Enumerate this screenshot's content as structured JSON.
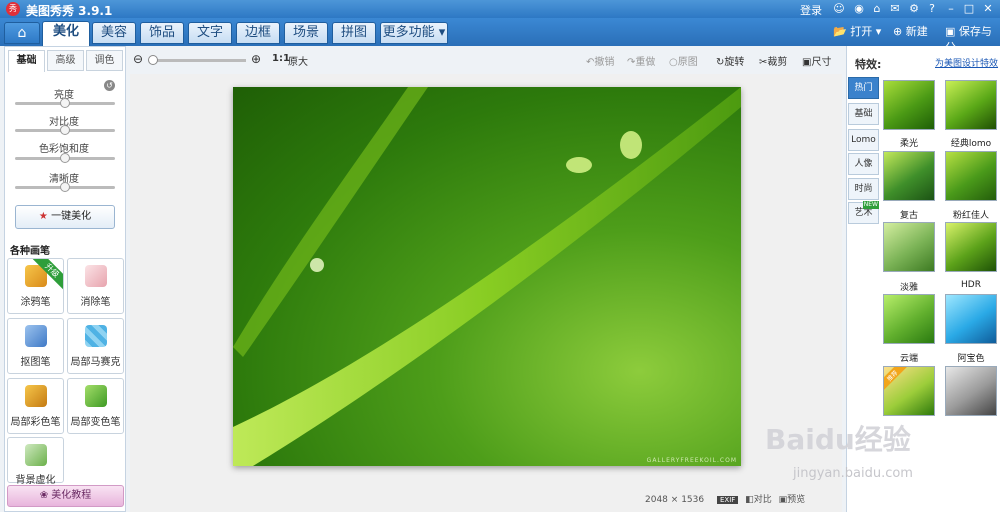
{
  "titlebar": {
    "logo": "秀",
    "title": "美图秀秀 3.9.1",
    "login": "登录"
  },
  "tabs": {
    "home_icon": "home-icon",
    "items": [
      "美化",
      "美容",
      "饰品",
      "文字",
      "边框",
      "场景",
      "拼图",
      "更多功能"
    ]
  },
  "actions": {
    "open": "打开",
    "new": "新建",
    "save": "保存与分"
  },
  "zoom": {
    "ratio": "1:1",
    "fit_label": "原大"
  },
  "toolbar": {
    "undo": "撤销",
    "redo": "重做",
    "original": "原图",
    "rotate": "旋转",
    "crop": "裁剪",
    "size": "尺寸"
  },
  "left": {
    "subtabs": [
      "基础",
      "高级",
      "调色"
    ],
    "sliders": [
      {
        "label": "亮度",
        "value": 0.5
      },
      {
        "label": "对比度",
        "value": 0.5
      },
      {
        "label": "色彩饱和度",
        "value": 0.5
      },
      {
        "label": "清晰度",
        "value": 0.5
      }
    ],
    "one_click": "一键美化",
    "brushes_title": "各种画笔",
    "brushes": [
      {
        "label": "涂鸦笔",
        "badge": "升级"
      },
      {
        "label": "消除笔"
      },
      {
        "label": "抠图笔"
      },
      {
        "label": "局部马赛克"
      },
      {
        "label": "局部彩色笔"
      },
      {
        "label": "局部变色笔"
      },
      {
        "label": "背景虚化"
      }
    ],
    "tutorial": "美化教程"
  },
  "photo": {
    "watermark": "GALLERYFREEKOIL.COM"
  },
  "status": {
    "width": "2048",
    "times": "×",
    "height": "1536",
    "exif": "EXIF",
    "compare": "对比",
    "preview": "预览"
  },
  "right": {
    "title": "特效:",
    "design_link": "为美图设计特效",
    "cats": [
      "热门",
      "基础",
      "Lomo",
      "人像",
      "时尚",
      "艺术"
    ],
    "new_badge": "NEW",
    "effects": [
      "柔光",
      "经典lomo",
      "复古",
      "粉红佳人",
      "淡雅",
      "HDR",
      "云端",
      "阿宝色"
    ],
    "effect_badge": "推荐"
  },
  "watermark": {
    "brand": "Baidu经验",
    "url": "jingyan.baidu.com"
  }
}
